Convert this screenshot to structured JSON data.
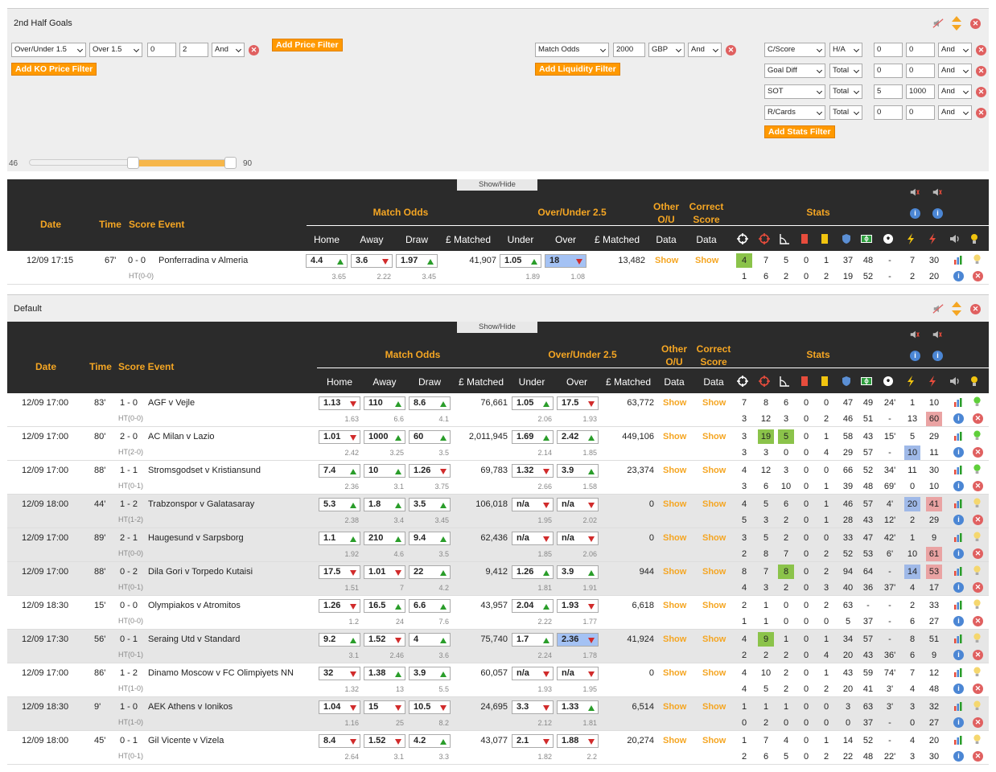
{
  "panel1": {
    "title": "2nd Half Goals",
    "price": {
      "market": "Over/Under 1.5",
      "selection": "Over 1.5",
      "min": "0",
      "max": "2",
      "logic": "And"
    },
    "add_price_filter": "Add Price Filter",
    "add_ko_price_filter": "Add KO Price Filter",
    "liquidity": {
      "market": "Match Odds",
      "amount": "2000",
      "currency": "GBP",
      "logic": "And"
    },
    "add_liquidity_filter": "Add Liquidity Filter",
    "stats_filters": [
      {
        "stat": "C/Score",
        "scope": "H/A",
        "min": "0",
        "max": "0",
        "logic": "And"
      },
      {
        "stat": "Goal Diff",
        "scope": "Total",
        "min": "0",
        "max": "0",
        "logic": "And"
      },
      {
        "stat": "SOT",
        "scope": "Total",
        "min": "5",
        "max": "1000",
        "logic": "And"
      },
      {
        "stat": "R/Cards",
        "scope": "Total",
        "min": "0",
        "max": "0",
        "logic": "And"
      }
    ],
    "add_stats_filter": "Add Stats Filter",
    "slider": {
      "min_label": "46",
      "max_label": "90",
      "low": 0.5,
      "high": 0.97
    }
  },
  "panel2": {
    "title": "Default"
  },
  "show_hide": "Show/Hide",
  "headers": {
    "date": "Date",
    "time": "Time",
    "score_event": "Score Event",
    "match_odds": "Match Odds",
    "over_under": "Over/Under 2.5",
    "other_ou_1": "Other",
    "other_ou_2": "O/U",
    "correct_1": "Correct",
    "correct_2": "Score",
    "stats": "Stats",
    "home": "Home",
    "away": "Away",
    "draw": "Draw",
    "matched": "£ Matched",
    "under": "Under",
    "over": "Over",
    "matched2": "£ Matched",
    "data1": "Data",
    "data2": "Data"
  },
  "show_label": "Show",
  "table1": [
    {
      "date": "12/09 17:15",
      "time": "67'",
      "score": "0 - 0",
      "event": "Ponferradina v Almeria",
      "ht": "HT(0-0)",
      "home": "4.4",
      "home_d": "up",
      "away": "3.6",
      "away_d": "dn",
      "draw": "1.97",
      "draw_d": "up",
      "matched": "41,907",
      "under": "1.05",
      "under_d": "up",
      "over": "18",
      "over_d": "dn",
      "over_blue": true,
      "matched2": "13,482",
      "home_s": "3.65",
      "away_s": "2.22",
      "draw_s": "3.45",
      "under_s": "1.89",
      "over_s": "1.08",
      "s1": [
        "4",
        "7",
        "5",
        "0",
        "1",
        "37",
        "48",
        "-",
        "7",
        "30"
      ],
      "s2": [
        "1",
        "6",
        "2",
        "0",
        "2",
        "19",
        "52",
        "-",
        "2",
        "20"
      ],
      "hl1": {
        "0": "g"
      },
      "hl2": {},
      "bulb": "#f5d76e",
      "bulb_green": false
    }
  ],
  "table2": [
    {
      "date": "12/09 17:00",
      "time": "83'",
      "score": "1 - 0",
      "event": "AGF v Vejle",
      "ht": "HT(0-0)",
      "home": "1.13",
      "home_d": "dn",
      "away": "110",
      "away_d": "up",
      "draw": "8.6",
      "draw_d": "up",
      "matched": "76,661",
      "under": "1.05",
      "under_d": "up",
      "over": "17.5",
      "over_d": "dn",
      "matched2": "63,772",
      "home_s": "1.63",
      "away_s": "6.6",
      "draw_s": "4.1",
      "under_s": "2.06",
      "over_s": "1.93",
      "s1": [
        "7",
        "8",
        "6",
        "0",
        "0",
        "47",
        "49",
        "24'",
        "1",
        "10"
      ],
      "s2": [
        "3",
        "12",
        "3",
        "0",
        "2",
        "46",
        "51",
        "-",
        "13",
        "60"
      ],
      "hl1": {},
      "hl2": {
        "9": "r"
      },
      "grey": false,
      "green": true
    },
    {
      "date": "12/09 17:00",
      "time": "80'",
      "score": "2 - 0",
      "event": "AC Milan v Lazio",
      "ht": "HT(2-0)",
      "home": "1.01",
      "home_d": "dn",
      "away": "1000",
      "away_d": "up",
      "draw": "60",
      "draw_d": "up",
      "matched": "2,011,945",
      "under": "1.69",
      "under_d": "up",
      "over": "2.42",
      "over_d": "up",
      "matched2": "449,106",
      "home_s": "2.42",
      "away_s": "3.25",
      "draw_s": "3.5",
      "under_s": "2.14",
      "over_s": "1.85",
      "s1": [
        "3",
        "19",
        "5",
        "0",
        "1",
        "58",
        "43",
        "15'",
        "5",
        "29"
      ],
      "s2": [
        "3",
        "3",
        "0",
        "0",
        "4",
        "29",
        "57",
        "-",
        "10",
        "11"
      ],
      "hl1": {
        "1": "g",
        "2": "g"
      },
      "hl2": {
        "8": "b"
      },
      "grey": false,
      "green": true
    },
    {
      "date": "12/09 17:00",
      "time": "88'",
      "score": "1 - 1",
      "event": "Stromsgodset v Kristiansund",
      "ht": "HT(0-1)",
      "home": "7.4",
      "home_d": "up",
      "away": "10",
      "away_d": "up",
      "draw": "1.26",
      "draw_d": "dn",
      "matched": "69,783",
      "under": "1.32",
      "under_d": "dn",
      "over": "3.9",
      "over_d": "up",
      "matched2": "23,374",
      "home_s": "2.36",
      "away_s": "3.1",
      "draw_s": "3.75",
      "under_s": "2.66",
      "over_s": "1.58",
      "s1": [
        "4",
        "12",
        "3",
        "0",
        "0",
        "66",
        "52",
        "34'",
        "11",
        "30"
      ],
      "s2": [
        "3",
        "6",
        "10",
        "0",
        "1",
        "39",
        "48",
        "69'",
        "0",
        "10"
      ],
      "hl1": {},
      "hl2": {},
      "grey": false,
      "green": true
    },
    {
      "date": "12/09 18:00",
      "time": "44'",
      "score": "1 - 2",
      "event": "Trabzonspor v Galatasaray",
      "ht": "HT(1-2)",
      "home": "5.3",
      "home_d": "up",
      "away": "1.8",
      "away_d": "up",
      "draw": "3.5",
      "draw_d": "up",
      "matched": "106,018",
      "under": "n/a",
      "under_d": "dn",
      "over": "n/a",
      "over_d": "dn",
      "matched2": "0",
      "home_s": "2.38",
      "away_s": "3.4",
      "draw_s": "3.45",
      "under_s": "1.95",
      "over_s": "2.02",
      "s1": [
        "4",
        "5",
        "6",
        "0",
        "1",
        "46",
        "57",
        "4'",
        "20",
        "41"
      ],
      "s2": [
        "5",
        "3",
        "2",
        "0",
        "1",
        "28",
        "43",
        "12'",
        "2",
        "29"
      ],
      "hl1": {
        "8": "b",
        "9": "r"
      },
      "hl2": {},
      "grey": true,
      "green": false
    },
    {
      "date": "12/09 17:00",
      "time": "89'",
      "score": "2 - 1",
      "event": "Haugesund v Sarpsborg",
      "ht": "HT(0-0)",
      "home": "1.1",
      "home_d": "up",
      "away": "210",
      "away_d": "up",
      "draw": "9.4",
      "draw_d": "up",
      "matched": "62,436",
      "under": "n/a",
      "under_d": "dn",
      "over": "n/a",
      "over_d": "dn",
      "matched2": "0",
      "home_s": "1.92",
      "away_s": "4.6",
      "draw_s": "3.5",
      "under_s": "1.85",
      "over_s": "2.06",
      "s1": [
        "3",
        "5",
        "2",
        "0",
        "0",
        "33",
        "47",
        "42'",
        "1",
        "9"
      ],
      "s2": [
        "2",
        "8",
        "7",
        "0",
        "2",
        "52",
        "53",
        "6'",
        "10",
        "61"
      ],
      "hl1": {},
      "hl2": {
        "9": "r"
      },
      "grey": true,
      "green": false
    },
    {
      "date": "12/09 17:00",
      "time": "88'",
      "score": "0 - 2",
      "event": "Dila Gori v Torpedo Kutaisi",
      "ht": "HT(0-1)",
      "home": "17.5",
      "home_d": "dn",
      "away": "1.01",
      "away_d": "dn",
      "draw": "22",
      "draw_d": "up",
      "matched": "9,412",
      "under": "1.26",
      "under_d": "up",
      "over": "3.9",
      "over_d": "up",
      "matched2": "944",
      "home_s": "1.51",
      "away_s": "7",
      "draw_s": "4.2",
      "under_s": "1.81",
      "over_s": "1.91",
      "s1": [
        "8",
        "7",
        "8",
        "0",
        "2",
        "94",
        "64",
        "-",
        "14",
        "53"
      ],
      "s2": [
        "4",
        "3",
        "2",
        "0",
        "3",
        "40",
        "36",
        "37'",
        "4",
        "17"
      ],
      "hl1": {
        "2": "g",
        "8": "b",
        "9": "r"
      },
      "hl2": {},
      "grey": true,
      "green": false
    },
    {
      "date": "12/09 18:30",
      "time": "15'",
      "score": "0 - 0",
      "event": "Olympiakos v Atromitos",
      "ht": "HT(0-0)",
      "home": "1.26",
      "home_d": "dn",
      "away": "16.5",
      "away_d": "up",
      "draw": "6.6",
      "draw_d": "up",
      "matched": "43,957",
      "under": "2.04",
      "under_d": "up",
      "over": "1.93",
      "over_d": "dn",
      "matched2": "6,618",
      "home_s": "1.2",
      "away_s": "24",
      "draw_s": "7.6",
      "under_s": "2.22",
      "over_s": "1.77",
      "s1": [
        "2",
        "1",
        "0",
        "0",
        "2",
        "63",
        "-",
        "2",
        "33"
      ],
      "s1f": [
        "2",
        "1",
        "0",
        "0",
        "2",
        "63",
        "-",
        "-",
        "2",
        "33"
      ],
      "s2": [
        "1",
        "1",
        "0",
        "0",
        "0",
        "5",
        "37",
        "-",
        "6",
        "27"
      ],
      "hl1": {},
      "hl2": {},
      "grey": false,
      "green": false
    },
    {
      "date": "12/09 17:30",
      "time": "56'",
      "score": "0 - 1",
      "event": "Seraing Utd v Standard",
      "ht": "HT(0-1)",
      "home": "9.2",
      "home_d": "up",
      "away": "1.52",
      "away_d": "dn",
      "draw": "4",
      "draw_d": "up",
      "matched": "75,740",
      "under": "1.7",
      "under_d": "up",
      "over": "2.36",
      "over_d": "dn",
      "over_blue": true,
      "matched2": "41,924",
      "home_s": "3.1",
      "away_s": "2.46",
      "draw_s": "3.6",
      "under_s": "2.24",
      "over_s": "1.78",
      "s1": [
        "4",
        "9",
        "1",
        "0",
        "1",
        "34",
        "57",
        "-",
        "8",
        "51"
      ],
      "s2": [
        "2",
        "2",
        "2",
        "0",
        "4",
        "20",
        "43",
        "36'",
        "6",
        "9"
      ],
      "hl1": {
        "1": "g"
      },
      "hl2": {},
      "grey": true,
      "green": false
    },
    {
      "date": "12/09 17:00",
      "time": "86'",
      "score": "1 - 2",
      "event": "Dinamo Moscow v FC Olimpiyets NN",
      "ht": "HT(1-0)",
      "home": "32",
      "home_d": "dn",
      "away": "1.38",
      "away_d": "up",
      "draw": "3.9",
      "draw_d": "up",
      "matched": "60,057",
      "under": "n/a",
      "under_d": "dn",
      "over": "n/a",
      "over_d": "dn",
      "matched2": "0",
      "home_s": "1.32",
      "away_s": "13",
      "draw_s": "5.5",
      "under_s": "1.93",
      "over_s": "1.95",
      "s1": [
        "4",
        "10",
        "2",
        "0",
        "1",
        "43",
        "59",
        "74'",
        "7",
        "12"
      ],
      "s2": [
        "4",
        "5",
        "2",
        "0",
        "2",
        "20",
        "41",
        "3'",
        "4",
        "48"
      ],
      "hl1": {},
      "hl2": {},
      "grey": false,
      "green": false
    },
    {
      "date": "12/09 18:30",
      "time": "9'",
      "score": "1 - 0",
      "event": "AEK Athens v Ionikos",
      "ht": "HT(1-0)",
      "home": "1.04",
      "home_d": "dn",
      "away": "15",
      "away_d": "dn",
      "draw": "10.5",
      "draw_d": "dn",
      "matched": "24,695",
      "under": "3.3",
      "under_d": "dn",
      "over": "1.33",
      "over_d": "up",
      "matched2": "6,514",
      "home_s": "1.16",
      "away_s": "25",
      "draw_s": "8.2",
      "under_s": "2.12",
      "over_s": "1.81",
      "s1": [
        "1",
        "1",
        "1",
        "0",
        "0",
        "3",
        "63",
        "3'",
        "3",
        "32"
      ],
      "s2": [
        "0",
        "2",
        "0",
        "0",
        "0",
        "0",
        "37",
        "-",
        "0",
        "27"
      ],
      "hl1": {},
      "hl2": {},
      "grey": true,
      "green": false
    },
    {
      "date": "12/09 18:00",
      "time": "45'",
      "score": "0 - 1",
      "event": "Gil Vicente v Vizela",
      "ht": "HT(0-1)",
      "home": "8.4",
      "home_d": "dn",
      "away": "1.52",
      "away_d": "dn",
      "draw": "4.2",
      "draw_d": "up",
      "matched": "43,077",
      "under": "2.1",
      "under_d": "dn",
      "over": "1.88",
      "over_d": "dn",
      "matched2": "20,274",
      "home_s": "2.64",
      "away_s": "3.1",
      "draw_s": "3.3",
      "under_s": "1.82",
      "over_s": "2.2",
      "s1": [
        "1",
        "7",
        "4",
        "0",
        "1",
        "14",
        "52",
        "-",
        "4",
        "20"
      ],
      "s2": [
        "2",
        "6",
        "5",
        "0",
        "2",
        "22",
        "48",
        "22'",
        "3",
        "30"
      ],
      "hl1": {},
      "hl2": {},
      "grey": false,
      "green": false
    }
  ]
}
